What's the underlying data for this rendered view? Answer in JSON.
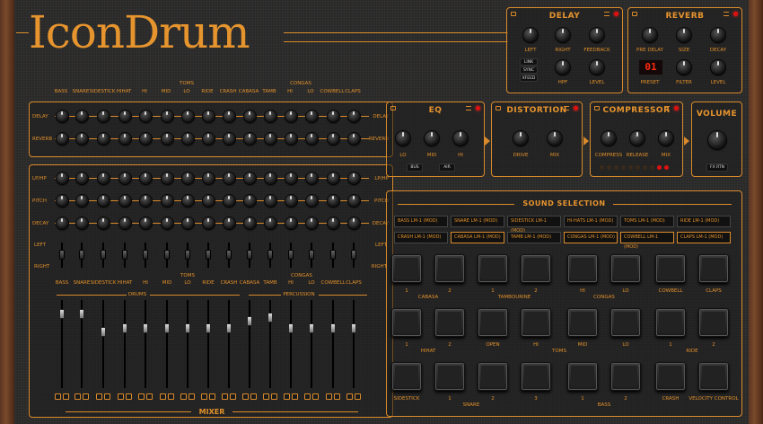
{
  "app": {
    "title_part1": "Icon",
    "title_part2": "Drum"
  },
  "delay": {
    "title": "DELAY",
    "knobs": [
      "LEFT",
      "RIGHT",
      "FEEDBACK",
      "HPF",
      "LEVEL"
    ],
    "sync": [
      "LINK",
      "SYNC",
      "XFEED"
    ]
  },
  "reverb": {
    "title": "REVERB",
    "knobs": [
      "PRE DELAY",
      "SIZE",
      "DECAY",
      "PRESET",
      "FILTER",
      "LEVEL"
    ],
    "preset_value": "01"
  },
  "channels": [
    "BASS",
    "SNARE",
    "SIDESTICK",
    "HIHAT",
    "HI",
    "MID",
    "LO",
    "RIDE",
    "CRASH",
    "CABASA",
    "TAMB",
    "HI",
    "LO",
    "COWBELL",
    "CLAPS"
  ],
  "groups": {
    "toms": "TOMS",
    "congas": "CONGAS",
    "drums": "DRUMS",
    "percussion": "PERCUSSION",
    "mixer": "MIXER"
  },
  "sends": {
    "delay": "DELAY",
    "reverb": "REVERB"
  },
  "filters": {
    "lphp": "LP/HP",
    "pitch": "PITCH",
    "decay": "DECAY",
    "left": "LEFT",
    "right": "RIGHT"
  },
  "eq": {
    "title": "EQ",
    "knobs": [
      "LO",
      "MID",
      "HI"
    ],
    "buttons": [
      "BUS",
      "AIR"
    ]
  },
  "distortion": {
    "title": "DISTORTION",
    "knobs": [
      "DRIVE",
      "MIX"
    ]
  },
  "compressor": {
    "title": "COMPRESSOR",
    "knobs": [
      "COMPRESS",
      "RELEASE",
      "MIX"
    ]
  },
  "volume": {
    "title": "VOLUME",
    "button": "FX RTN"
  },
  "sound": {
    "title": "SOUND SELECTION",
    "slots": [
      "BASS LM-1 (MOD)",
      "SNARE LM-1 (MOD)",
      "SIDESTICK LM-1 (MOD)",
      "HI-HATS LM-1 (MOD)",
      "TOMS LM-1 (MOD)",
      "RIDE LM-1 (MOD)",
      "CRASH LM-1 (MOD)",
      "CABASA LM-1 (MOD)",
      "TAMB LM-1 (MOD)",
      "CONGAS LM-1 (MOD)",
      "COWBELL LM-1 (MOD)",
      "CLAPS LM-1 (MOD)"
    ],
    "row1": [
      "1",
      "2",
      "1",
      "2",
      "HI",
      "LO",
      "COWBELL",
      "CLAPS"
    ],
    "row1_groups": [
      "CABASA",
      "TAMBOURINE",
      "CONGAS"
    ],
    "row2": [
      "1",
      "2",
      "OPEN",
      "HI",
      "MID",
      "LO",
      "1",
      "2"
    ],
    "row2_groups": [
      "HIHAT",
      "TOMS",
      "RIDE"
    ],
    "row3": [
      "SIDESTICK",
      "1",
      "2",
      "3",
      "1",
      "2",
      "CRASH",
      "VELOCITY CONTROL"
    ],
    "row3_groups": [
      "SNARE",
      "BASS"
    ]
  },
  "colors": {
    "accent": "#d98a2b",
    "led": "#e01010",
    "panel": "#2a2928"
  }
}
